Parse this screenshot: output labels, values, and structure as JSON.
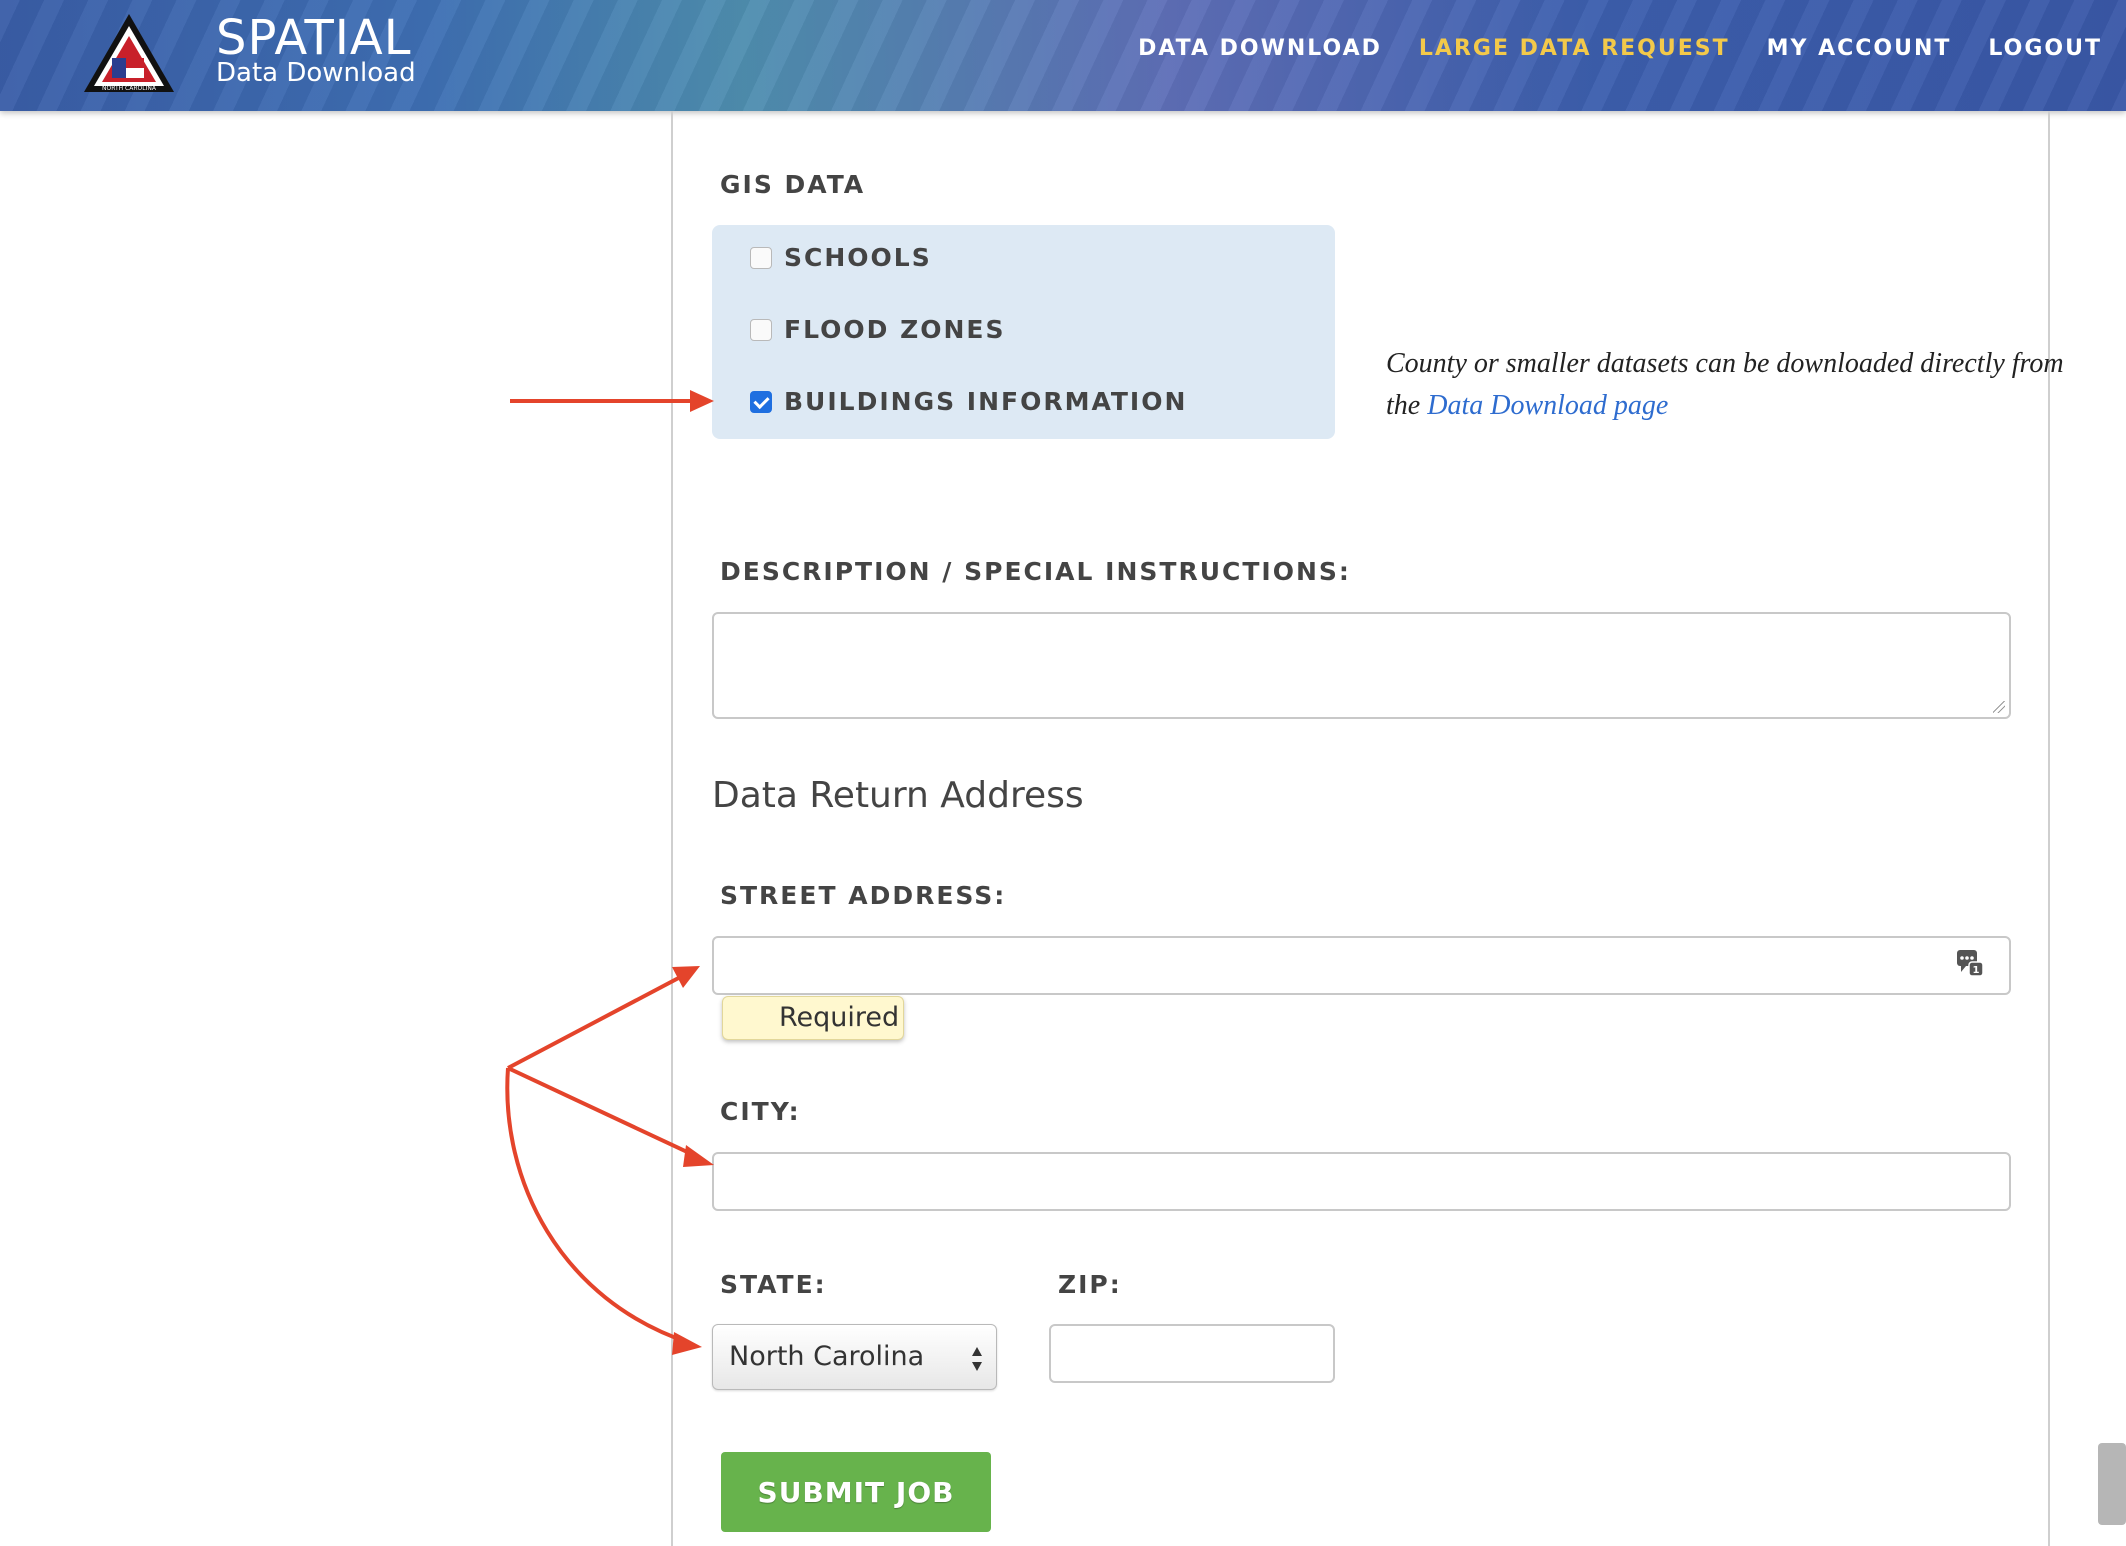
{
  "header": {
    "logo_text": "NORTH CAROLINA",
    "brand_title": "SPATIAL",
    "brand_subtitle": "Data Download",
    "nav": [
      {
        "label": "DATA DOWNLOAD",
        "active": false
      },
      {
        "label": "LARGE DATA REQUEST",
        "active": true
      },
      {
        "label": "MY ACCOUNT",
        "active": false
      },
      {
        "label": "LOGOUT",
        "active": false
      }
    ]
  },
  "gis": {
    "label": "GIS DATA",
    "options": [
      {
        "label": "SCHOOLS",
        "checked": false
      },
      {
        "label": "FLOOD ZONES",
        "checked": false
      },
      {
        "label": "BUILDINGS INFORMATION",
        "checked": true
      }
    ],
    "note_text": "County or smaller datasets can be downloaded directly from the",
    "note_link": "Data Download page"
  },
  "description": {
    "label": "DESCRIPTION / SPECIAL INSTRUCTIONS:",
    "value": ""
  },
  "address": {
    "title": "Data Return Address",
    "street_label": "STREET ADDRESS:",
    "street_value": "",
    "tooltip": "Required",
    "city_label": "CITY:",
    "city_value": "",
    "state_label": "STATE:",
    "state_value": "North Carolina",
    "zip_label": "ZIP:",
    "zip_value": ""
  },
  "submit_label": "SUBMIT JOB",
  "colors": {
    "nav_active": "#f3c94a",
    "submit": "#67b34c",
    "gis_box": "#dde9f4",
    "annotation_arrow": "#e4442b",
    "link": "#2e6ccf"
  }
}
